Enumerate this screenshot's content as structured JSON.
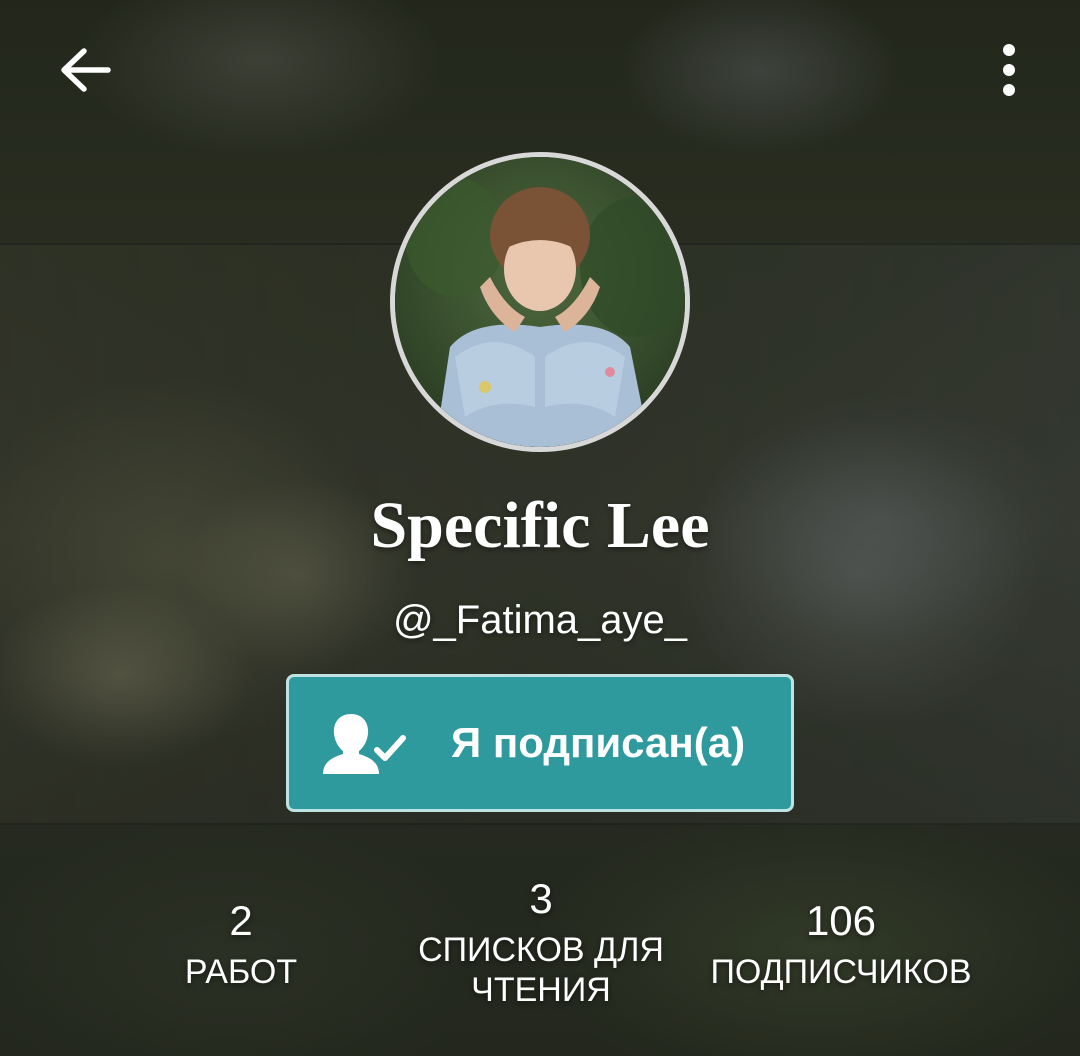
{
  "profile": {
    "display_name": "Specific Lee",
    "username": "@_Fatima_aye_"
  },
  "follow_button": {
    "label": "Я подписан(а)",
    "icon": "user-check-icon"
  },
  "header": {
    "back_icon": "arrow-left-icon",
    "menu_icon": "more-vertical-icon"
  },
  "stats": [
    {
      "value": "2",
      "label": "РАБОТ"
    },
    {
      "value": "3",
      "label": "СПИСКОВ ДЛЯ\nЧТЕНИЯ"
    },
    {
      "value": "106",
      "label": "ПОДПИСЧИКОВ"
    }
  ],
  "colors": {
    "accent": "#2f9a9d",
    "accent_border": "#bfe3e3",
    "text": "#ffffff"
  }
}
